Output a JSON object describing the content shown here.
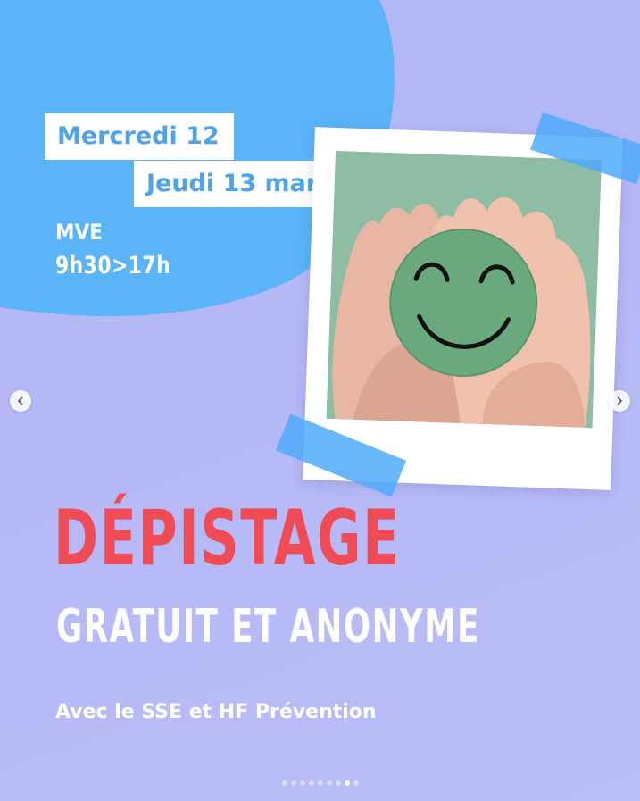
{
  "post": {
    "dates": [
      "Mercredi 12",
      "Jeudi 13 mars"
    ],
    "venue": "MVE",
    "hours": "9h30>17h",
    "title": "DÉPISTAGE",
    "subtitle": "GRATUIT ET ANONYME",
    "tagline": "Avec le SSE et HF Prévention"
  },
  "carousel": {
    "prev_icon": "chevron-left-icon",
    "next_icon": "chevron-right-icon",
    "slide_count": 9,
    "active_index": 7
  },
  "colors": {
    "background": "#b5b8f5",
    "blob": "#5ab4f7",
    "date_text": "#4fa3e6",
    "title": "#f04c58",
    "tape": "#50aafa",
    "smiley": "#6aa87e"
  }
}
